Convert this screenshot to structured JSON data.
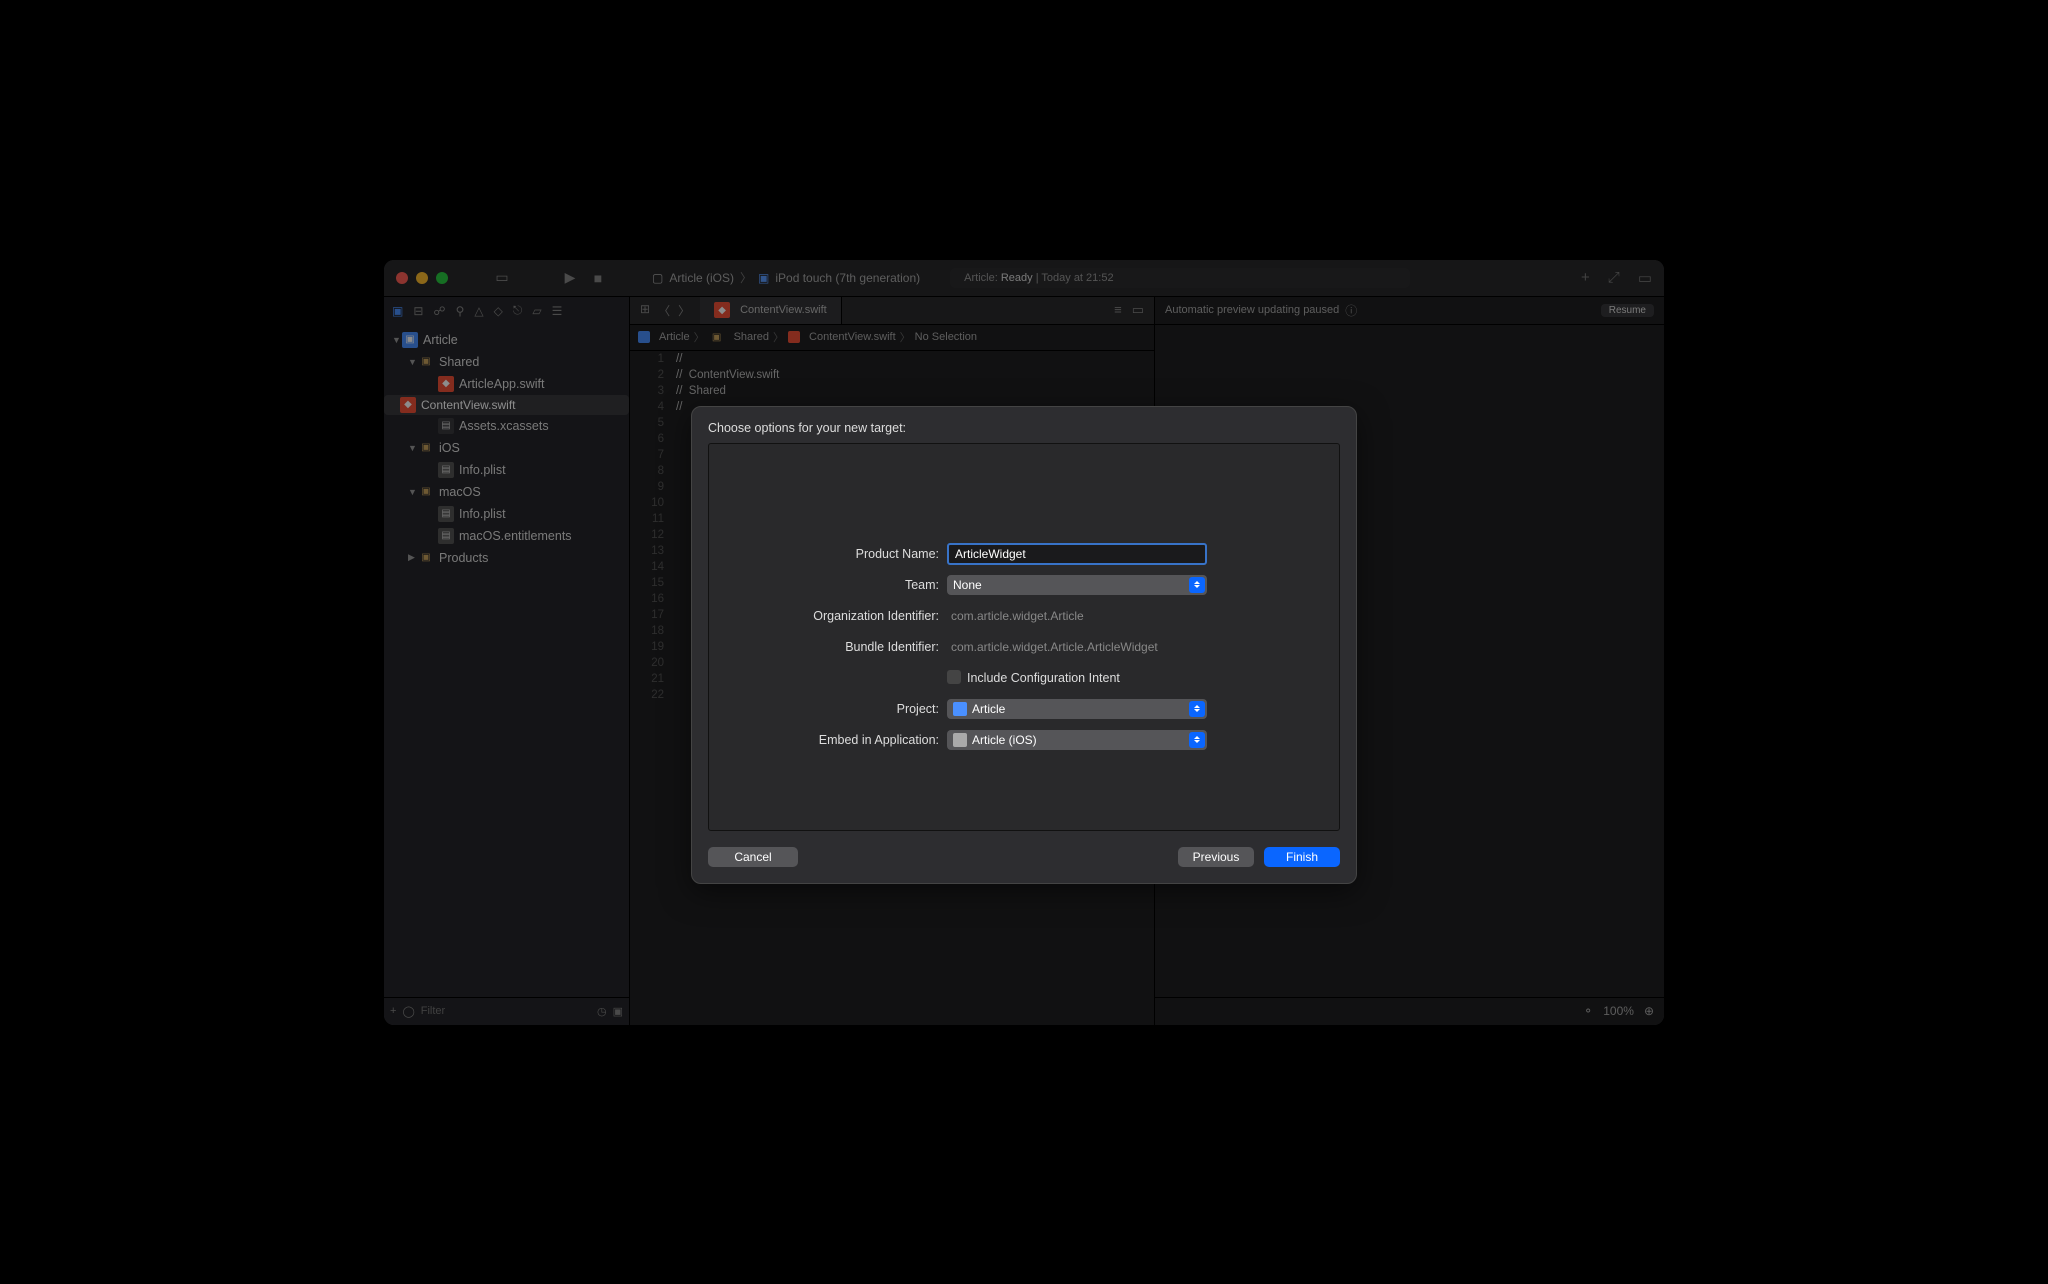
{
  "titlebar": {
    "scheme_target": "Article (iOS)",
    "scheme_device": "iPod touch (7th generation)",
    "status_prefix": "Article:",
    "status_state": "Ready",
    "status_time": "Today at 21:52"
  },
  "navigator": {
    "items": [
      {
        "label": "Article",
        "type": "app",
        "indent": 0,
        "open": true
      },
      {
        "label": "Shared",
        "type": "fold",
        "indent": 1,
        "open": true
      },
      {
        "label": "ArticleApp.swift",
        "type": "swift",
        "indent": 2
      },
      {
        "label": "ContentView.swift",
        "type": "swift",
        "indent": 2,
        "selected": true
      },
      {
        "label": "Assets.xcassets",
        "type": "asset",
        "indent": 2
      },
      {
        "label": "iOS",
        "type": "fold",
        "indent": 1,
        "open": true
      },
      {
        "label": "Info.plist",
        "type": "plist",
        "indent": 2
      },
      {
        "label": "macOS",
        "type": "fold",
        "indent": 1,
        "open": true
      },
      {
        "label": "Info.plist",
        "type": "plist",
        "indent": 2
      },
      {
        "label": "macOS.entitlements",
        "type": "plist",
        "indent": 2
      },
      {
        "label": "Products",
        "type": "fold",
        "indent": 1,
        "open": false
      }
    ],
    "filter_placeholder": "Filter"
  },
  "tab": {
    "label": "ContentView.swift"
  },
  "jumpbar": {
    "p0": "Article",
    "p1": "Shared",
    "p2": "ContentView.swift",
    "p3": "No Selection"
  },
  "code_lines": [
    "//",
    "//  ContentView.swift",
    "//  Shared",
    "//",
    "",
    "",
    "",
    "",
    "",
    "",
    "",
    "",
    "",
    "",
    "",
    "",
    "",
    "",
    "",
    "",
    "",
    ""
  ],
  "preview": {
    "message": "Automatic preview updating paused",
    "resume": "Resume",
    "zoom": "100%"
  },
  "sheet": {
    "title": "Choose options for your new target:",
    "labels": {
      "product": "Product Name:",
      "team": "Team:",
      "org": "Organization Identifier:",
      "bundle": "Bundle Identifier:",
      "intent": "Include Configuration Intent",
      "project": "Project:",
      "embed": "Embed in Application:"
    },
    "values": {
      "product": "ArticleWidget",
      "team": "None",
      "org": "com.article.widget.Article",
      "bundle": "com.article.widget.Article.ArticleWidget",
      "project": "Article",
      "embed": "Article (iOS)"
    },
    "buttons": {
      "cancel": "Cancel",
      "previous": "Previous",
      "finish": "Finish"
    }
  }
}
